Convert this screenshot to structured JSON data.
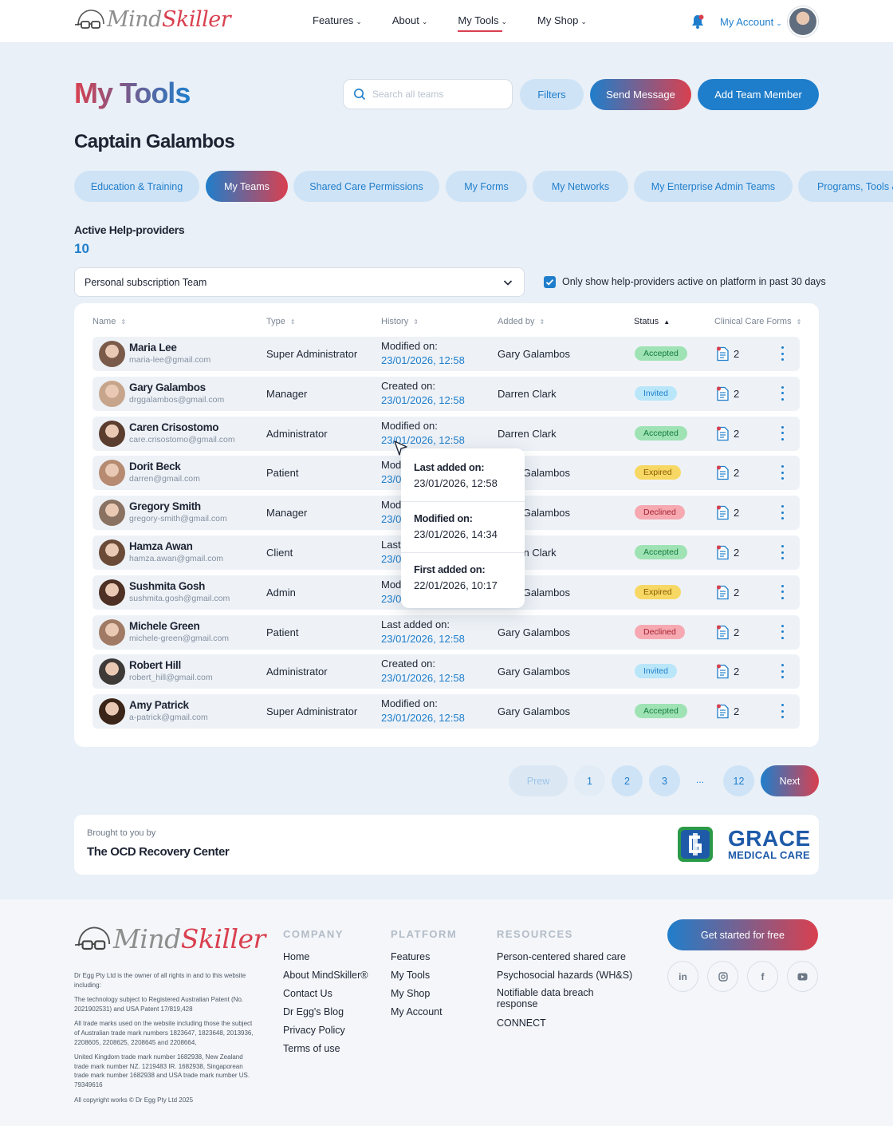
{
  "brand": {
    "name_gray": "Mind",
    "name_red": "Skiller"
  },
  "nav": {
    "items": [
      {
        "label": "Features"
      },
      {
        "label": "About"
      },
      {
        "label": "My Tools"
      },
      {
        "label": "My Shop"
      }
    ],
    "account": "My Account"
  },
  "page": {
    "title": "My Tools",
    "subtitle": "Captain Galambos",
    "search_placeholder": "Search all teams",
    "filters": "Filters",
    "send_message": "Send Message",
    "add_member": "Add Team Member"
  },
  "tabs": [
    {
      "label": "Education & Training"
    },
    {
      "label": "My Teams",
      "active": true
    },
    {
      "label": "Shared Care Permissions"
    },
    {
      "label": "My Forms"
    },
    {
      "label": "My Networks"
    },
    {
      "label": "My Enterprise Admin Teams"
    },
    {
      "label": "Programs, Tools &"
    }
  ],
  "summary": {
    "label": "Active Help-providers",
    "count": "10"
  },
  "filter": {
    "team": "Personal subscription Team",
    "only_active_label": "Only show help-providers active on platform in past 30 days",
    "only_active_checked": true
  },
  "table": {
    "headers": {
      "name": "Name",
      "type": "Type",
      "history": "History",
      "added_by": "Added by",
      "status": "Status",
      "forms": "Clinical Care Forms"
    },
    "rows": [
      {
        "name": "Maria Lee",
        "email": "maria-lee@gmail.com",
        "type": "Super Administrator",
        "history_label": "Modified on:",
        "history_date": "23/01/2026, 12:58",
        "added_by": "Gary Galambos",
        "status": "Accepted",
        "forms": "2"
      },
      {
        "name": "Gary Galambos",
        "email": "drggalambos@gmail.com",
        "type": "Manager",
        "history_label": "Created on:",
        "history_date": "23/01/2026, 12:58",
        "added_by": "Darren Clark",
        "status": "Invited",
        "forms": "2"
      },
      {
        "name": "Caren Crisostomo",
        "email": "care.crisostomo@gmail.com",
        "type": "Administrator",
        "history_label": "Modified on:",
        "history_date": "23/01/2026, 12:58",
        "added_by": "Darren Clark",
        "status": "Accepted",
        "forms": "2"
      },
      {
        "name": "Dorit Beck",
        "email": "darren@gmail.com",
        "type": "Patient",
        "history_label": "Modified on:",
        "history_date": "23/01/2026, 12:58",
        "added_by": "Gary Galambos",
        "status": "Expired",
        "forms": "2"
      },
      {
        "name": "Gregory Smith",
        "email": "gregory-smith@gmail.com",
        "type": "Manager",
        "history_label": "Modified on:",
        "history_date": "23/01/2026, 12:58",
        "added_by": "Gary Galambos",
        "status": "Declined",
        "forms": "2"
      },
      {
        "name": "Hamza Awan",
        "email": "hamza.awan@gmail.com",
        "type": "Client",
        "history_label": "Last added on:",
        "history_date": "23/01/2026, 12:58",
        "added_by": "Darren Clark",
        "status": "Accepted",
        "forms": "2"
      },
      {
        "name": "Sushmita Gosh",
        "email": "sushmita.gosh@gmail.com",
        "type": "Admin",
        "history_label": "Modified on:",
        "history_date": "23/01/2026, 12:58",
        "added_by": "Gary Galambos",
        "status": "Expired",
        "forms": "2"
      },
      {
        "name": "Michele Green",
        "email": "michele-green@gmail.com",
        "type": "Patient",
        "history_label": "Last added on:",
        "history_date": "23/01/2026, 12:58",
        "added_by": "Gary Galambos",
        "status": "Declined",
        "forms": "2"
      },
      {
        "name": "Robert Hill",
        "email": "robert_hill@gmail.com",
        "type": "Administrator",
        "history_label": "Created on:",
        "history_date": "23/01/2026, 12:58",
        "added_by": "Gary Galambos",
        "status": "Invited",
        "forms": "2"
      },
      {
        "name": "Amy Patrick",
        "email": "a-patrick@gmail.com",
        "type": "Super Administrator",
        "history_label": "Modified on:",
        "history_date": "23/01/2026, 12:58",
        "added_by": "Gary Galambos",
        "status": "Accepted",
        "forms": "2"
      }
    ]
  },
  "tooltip": {
    "items": [
      {
        "label": "Last added on:",
        "value": "23/01/2026, 12:58"
      },
      {
        "label": "Modified on:",
        "value": "23/01/2026, 14:34"
      },
      {
        "label": "First added on:",
        "value": "22/01/2026, 10:17"
      }
    ]
  },
  "pagination": {
    "prev": "Prew",
    "pages": [
      "1",
      "2",
      "3"
    ],
    "ellipsis": "...",
    "last": "12",
    "next": "Next",
    "current": "1"
  },
  "sponsor": {
    "caption": "Brought to you by",
    "name": "The OCD Recovery Center",
    "logo_line1": "GRACE",
    "logo_line2": "MEDICAL CARE"
  },
  "footer": {
    "legal": [
      "Dr Egg Pty Ltd is the owner of all rights in and to this website including:",
      "The technology subject to Registered Australian Patent (No. 2021902531) and USA Patent 17/819,428",
      "All trade marks used on the website including those the subject of Australian trade mark numbers 1823647, 1823648, 2013936, 2208605, 2208625, 2208645 and 2208664,",
      "United Kingdom trade mark number 1682938, New Zealand trade mark number NZ. 1219483 IR. 1682938, Singaporean trade mark number 1682938 and USA trade mark number US. 79349616",
      "All copyright works © Dr Egg Pty Ltd 2025"
    ],
    "company": {
      "heading": "COMPANY",
      "links": [
        "Home",
        "About MindSkiller®",
        "Contact Us",
        "Dr Egg's Blog",
        "Privacy Policy",
        "Terms of use"
      ]
    },
    "platform": {
      "heading": "PLATFORM",
      "links": [
        "Features",
        "My Tools",
        "My Shop",
        "My Account"
      ]
    },
    "resources": {
      "heading": "RESOURCES",
      "links": [
        "Person-centered shared care",
        "Psychosocial hazards (WH&S)",
        "Notifiable data breach response",
        "CONNECT"
      ]
    },
    "cta": "Get started for free",
    "social": [
      "in",
      "instagram-icon",
      "f",
      "youtube-icon"
    ]
  },
  "colors": {
    "brand_red": "#d9404f",
    "brand_blue": "#1f7ecb"
  }
}
